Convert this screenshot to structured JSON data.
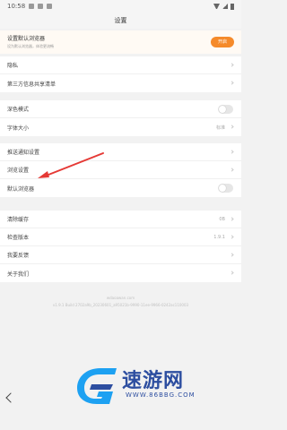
{
  "status": {
    "time": "10:58"
  },
  "title": "设置",
  "banner": {
    "title": "设置默认浏览器",
    "subtitle": "设为默认浏览器，体验更流畅",
    "button_label": "开启"
  },
  "group1": [
    {
      "label": "隐私"
    },
    {
      "label": "第三方信息共享清单"
    }
  ],
  "group2": [
    {
      "label": "深色模式",
      "toggle": false
    },
    {
      "label": "字体大小",
      "value": "标准"
    }
  ],
  "group3": [
    {
      "label": "推送通知设置"
    },
    {
      "label": "浏览设置"
    },
    {
      "label": "默认浏览器",
      "toggle": false
    }
  ],
  "group4": [
    {
      "label": "清除缓存",
      "value": "0B"
    },
    {
      "label": "检查版本",
      "value": "1.9.1"
    },
    {
      "label": "我要反馈"
    },
    {
      "label": "关于我们"
    }
  ],
  "footer": {
    "line1": "wdaoawan.com",
    "line2": "v1.9.1 Build 2702a9b_20230601_a95021b-9990-11ee-9966-0242ac110003"
  },
  "watermark": {
    "text": "速游网",
    "url": "WWW.86BBG.COM"
  },
  "colors": {
    "accent": "#f58a2a",
    "arrow": "#e53935",
    "watermark": "#2d4ea0"
  }
}
